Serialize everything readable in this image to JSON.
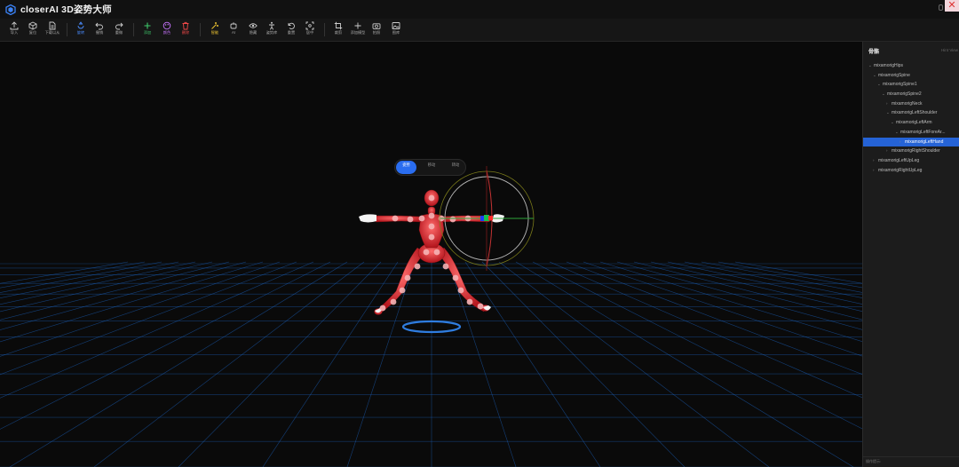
{
  "app": {
    "title": "closerAI 3D姿势大师",
    "close_label": "✕"
  },
  "toolbar": {
    "items": [
      {
        "label": "导入",
        "icon": "upload-icon"
      },
      {
        "label": "复位",
        "icon": "box-reset-icon"
      },
      {
        "label": "下载以从",
        "icon": "document-icon"
      },
      {
        "label": "旋转",
        "icon": "rotate-icon"
      },
      {
        "label": "撤销",
        "icon": "undo-icon"
      },
      {
        "label": "重做",
        "icon": "redo-icon"
      },
      {
        "label": "添加",
        "icon": "plus-icon"
      },
      {
        "label": "颜色",
        "icon": "palette-icon"
      },
      {
        "label": "删除",
        "icon": "trash-icon"
      },
      {
        "label": "智能",
        "icon": "magic-icon"
      },
      {
        "label": "AI",
        "icon": "ai-icon"
      },
      {
        "label": "隐藏",
        "icon": "eye-icon"
      },
      {
        "label": "姿势库",
        "icon": "person-icon"
      },
      {
        "label": "重置",
        "icon": "reset-icon"
      },
      {
        "label": "居中",
        "icon": "focus-icon"
      },
      {
        "label": "裁剪",
        "icon": "crop-icon"
      },
      {
        "label": "添加模型",
        "icon": "add-model-icon"
      },
      {
        "label": "拍照",
        "icon": "camera-icon"
      },
      {
        "label": "图库",
        "icon": "image-icon"
      }
    ]
  },
  "mode_switch": {
    "options": [
      "姿势",
      "移动",
      "转动"
    ],
    "active": "姿势"
  },
  "panel": {
    "title": "骨骼",
    "subtitle": "Hint View",
    "footer": "操作提示:",
    "bones": [
      {
        "name": "mixamorigHips",
        "depth": 0,
        "expanded": true
      },
      {
        "name": "mixamorigSpine",
        "depth": 1,
        "expanded": true
      },
      {
        "name": "mixamorigSpine1",
        "depth": 2,
        "expanded": true
      },
      {
        "name": "mixamorigSpine2",
        "depth": 3,
        "expanded": true
      },
      {
        "name": "mixamorigNeck",
        "depth": 4,
        "expanded": false
      },
      {
        "name": "mixamorigLeftShoulder",
        "depth": 4,
        "expanded": true
      },
      {
        "name": "mixamorigLeftArm",
        "depth": 5,
        "expanded": true
      },
      {
        "name": "mixamorigLeftForeAr...",
        "depth": 6,
        "expanded": true
      },
      {
        "name": "mixamorigLeftHand",
        "depth": 7,
        "expanded": false,
        "selected": true
      },
      {
        "name": "mixamorigRightShoulder",
        "depth": 4,
        "expanded": false
      },
      {
        "name": "mixamorigLeftUpLeg",
        "depth": 1,
        "expanded": false
      },
      {
        "name": "mixamorigRightUpLeg",
        "depth": 1,
        "expanded": false
      }
    ]
  },
  "colors": {
    "accent": "#2563d6",
    "figure": "#e0393e",
    "grid": "#1d6bd0",
    "add": "#3ec96b",
    "palette": "#c874ff",
    "delete": "#f04848",
    "magic": "#f2c832"
  }
}
